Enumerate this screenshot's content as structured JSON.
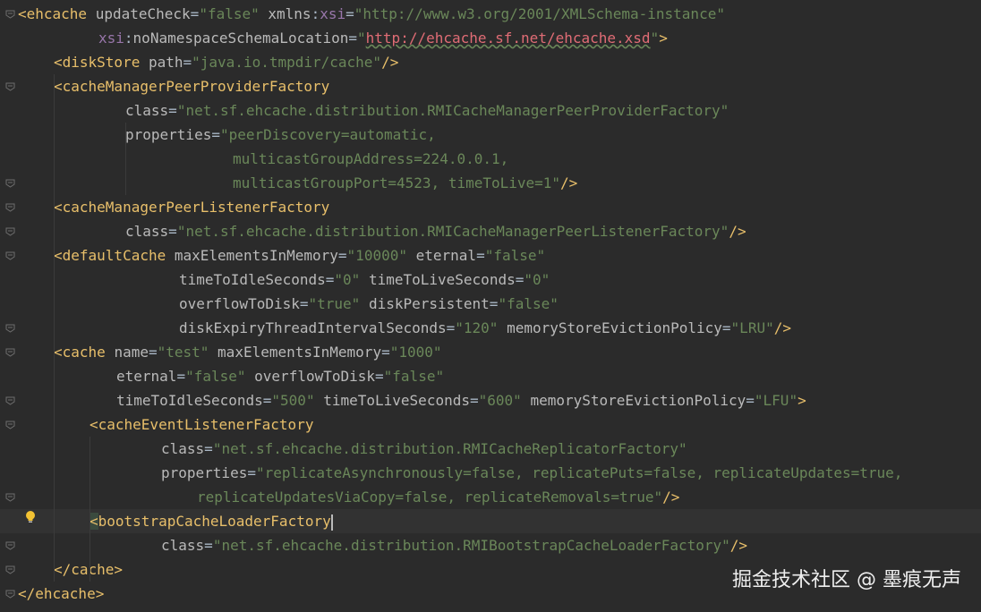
{
  "editor": {
    "lines": [
      {
        "indent": 0,
        "tokens": [
          {
            "c": "t-tag",
            "t": "<ehcache"
          },
          {
            "c": "t-plain",
            "t": " "
          },
          {
            "c": "t-attr",
            "t": "updateCheck"
          },
          {
            "c": "t-plain",
            "t": "="
          },
          {
            "c": "t-val",
            "t": "\"false\""
          },
          {
            "c": "t-plain",
            "t": " "
          },
          {
            "c": "t-attr",
            "t": "xmlns"
          },
          {
            "c": "t-plain",
            "t": ":"
          },
          {
            "c": "t-ns",
            "t": "xsi"
          },
          {
            "c": "t-plain",
            "t": "="
          },
          {
            "c": "t-val",
            "t": "\"http://www.w3.org/2001/XMLSchema-instance\""
          }
        ]
      },
      {
        "indent": 9,
        "tokens": [
          {
            "c": "t-ns",
            "t": "xsi"
          },
          {
            "c": "t-plain",
            "t": ":"
          },
          {
            "c": "t-attr",
            "t": "noNamespaceSchemaLocation"
          },
          {
            "c": "t-plain",
            "t": "="
          },
          {
            "c": "t-val",
            "t": "\""
          },
          {
            "c": "t-url",
            "t": "http://ehcache.sf.net/ehcache.xsd"
          },
          {
            "c": "t-val",
            "t": "\""
          },
          {
            "c": "t-tag",
            "t": ">"
          }
        ]
      },
      {
        "indent": 4,
        "tokens": [
          {
            "c": "t-tag",
            "t": "<diskStore"
          },
          {
            "c": "t-plain",
            "t": " "
          },
          {
            "c": "t-attr",
            "t": "path"
          },
          {
            "c": "t-plain",
            "t": "="
          },
          {
            "c": "t-val",
            "t": "\"java.io.tmpdir/cache\""
          },
          {
            "c": "t-tag",
            "t": "/>"
          }
        ]
      },
      {
        "indent": 4,
        "tokens": [
          {
            "c": "t-tag",
            "t": "<cacheManagerPeerProviderFactory"
          }
        ]
      },
      {
        "indent": 12,
        "tokens": [
          {
            "c": "t-attr",
            "t": "class"
          },
          {
            "c": "t-plain",
            "t": "="
          },
          {
            "c": "t-val",
            "t": "\"net.sf.ehcache.distribution.RMICacheManagerPeerProviderFactory\""
          }
        ]
      },
      {
        "indent": 12,
        "tokens": [
          {
            "c": "t-attr",
            "t": "properties"
          },
          {
            "c": "t-plain",
            "t": "="
          },
          {
            "c": "t-val",
            "t": "\"peerDiscovery=automatic,"
          }
        ]
      },
      {
        "indent": 24,
        "tokens": [
          {
            "c": "t-val",
            "t": "multicastGroupAddress=224.0.0.1,"
          }
        ]
      },
      {
        "indent": 24,
        "tokens": [
          {
            "c": "t-val",
            "t": "multicastGroupPort=4523, timeToLive=1\""
          },
          {
            "c": "t-tag",
            "t": "/>"
          }
        ]
      },
      {
        "indent": 4,
        "tokens": [
          {
            "c": "t-tag",
            "t": "<cacheManagerPeerListenerFactory"
          }
        ]
      },
      {
        "indent": 12,
        "tokens": [
          {
            "c": "t-attr",
            "t": "class"
          },
          {
            "c": "t-plain",
            "t": "="
          },
          {
            "c": "t-val",
            "t": "\"net.sf.ehcache.distribution.RMICacheManagerPeerListenerFactory\""
          },
          {
            "c": "t-tag",
            "t": "/>"
          }
        ]
      },
      {
        "indent": 4,
        "tokens": [
          {
            "c": "t-tag",
            "t": "<defaultCache"
          },
          {
            "c": "t-plain",
            "t": " "
          },
          {
            "c": "t-attr",
            "t": "maxElementsInMemory"
          },
          {
            "c": "t-plain",
            "t": "="
          },
          {
            "c": "t-val",
            "t": "\"10000\""
          },
          {
            "c": "t-plain",
            "t": " "
          },
          {
            "c": "t-attr",
            "t": "eternal"
          },
          {
            "c": "t-plain",
            "t": "="
          },
          {
            "c": "t-val",
            "t": "\"false\""
          }
        ]
      },
      {
        "indent": 18,
        "tokens": [
          {
            "c": "t-attr",
            "t": "timeToIdleSeconds"
          },
          {
            "c": "t-plain",
            "t": "="
          },
          {
            "c": "t-val",
            "t": "\"0\""
          },
          {
            "c": "t-plain",
            "t": " "
          },
          {
            "c": "t-attr",
            "t": "timeToLiveSeconds"
          },
          {
            "c": "t-plain",
            "t": "="
          },
          {
            "c": "t-val",
            "t": "\"0\""
          }
        ]
      },
      {
        "indent": 18,
        "tokens": [
          {
            "c": "t-attr",
            "t": "overflowToDisk"
          },
          {
            "c": "t-plain",
            "t": "="
          },
          {
            "c": "t-val",
            "t": "\"true\""
          },
          {
            "c": "t-plain",
            "t": " "
          },
          {
            "c": "t-attr",
            "t": "diskPersistent"
          },
          {
            "c": "t-plain",
            "t": "="
          },
          {
            "c": "t-val",
            "t": "\"false\""
          }
        ]
      },
      {
        "indent": 18,
        "tokens": [
          {
            "c": "t-attr",
            "t": "diskExpiryThreadIntervalSeconds"
          },
          {
            "c": "t-plain",
            "t": "="
          },
          {
            "c": "t-val",
            "t": "\"120\""
          },
          {
            "c": "t-plain",
            "t": " "
          },
          {
            "c": "t-attr",
            "t": "memoryStoreEvictionPolicy"
          },
          {
            "c": "t-plain",
            "t": "="
          },
          {
            "c": "t-val",
            "t": "\"LRU\""
          },
          {
            "c": "t-tag",
            "t": "/>"
          }
        ]
      },
      {
        "indent": 4,
        "tokens": [
          {
            "c": "t-tag",
            "t": "<cache"
          },
          {
            "c": "t-plain",
            "t": " "
          },
          {
            "c": "t-attr",
            "t": "name"
          },
          {
            "c": "t-plain",
            "t": "="
          },
          {
            "c": "t-val",
            "t": "\"test\""
          },
          {
            "c": "t-plain",
            "t": " "
          },
          {
            "c": "t-attr",
            "t": "maxElementsInMemory"
          },
          {
            "c": "t-plain",
            "t": "="
          },
          {
            "c": "t-val",
            "t": "\"1000\""
          }
        ]
      },
      {
        "indent": 11,
        "tokens": [
          {
            "c": "t-attr",
            "t": "eternal"
          },
          {
            "c": "t-plain",
            "t": "="
          },
          {
            "c": "t-val",
            "t": "\"false\""
          },
          {
            "c": "t-plain",
            "t": " "
          },
          {
            "c": "t-attr",
            "t": "overflowToDisk"
          },
          {
            "c": "t-plain",
            "t": "="
          },
          {
            "c": "t-val",
            "t": "\"false\""
          }
        ]
      },
      {
        "indent": 11,
        "tokens": [
          {
            "c": "t-attr",
            "t": "timeToIdleSeconds"
          },
          {
            "c": "t-plain",
            "t": "="
          },
          {
            "c": "t-val",
            "t": "\"500\""
          },
          {
            "c": "t-plain",
            "t": " "
          },
          {
            "c": "t-attr",
            "t": "timeToLiveSeconds"
          },
          {
            "c": "t-plain",
            "t": "="
          },
          {
            "c": "t-val",
            "t": "\"600\""
          },
          {
            "c": "t-plain",
            "t": " "
          },
          {
            "c": "t-attr",
            "t": "memoryStoreEvictionPolicy"
          },
          {
            "c": "t-plain",
            "t": "="
          },
          {
            "c": "t-val",
            "t": "\"LFU\""
          },
          {
            "c": "t-tag",
            "t": ">"
          }
        ]
      },
      {
        "indent": 8,
        "tokens": [
          {
            "c": "t-tag",
            "t": "<cacheEventListenerFactory"
          }
        ]
      },
      {
        "indent": 16,
        "tokens": [
          {
            "c": "t-attr",
            "t": "class"
          },
          {
            "c": "t-plain",
            "t": "="
          },
          {
            "c": "t-val",
            "t": "\"net.sf.ehcache.distribution.RMICacheReplicatorFactory\""
          }
        ]
      },
      {
        "indent": 16,
        "tokens": [
          {
            "c": "t-attr",
            "t": "properties"
          },
          {
            "c": "t-plain",
            "t": "="
          },
          {
            "c": "t-val",
            "t": "\"replicateAsynchronously=false, replicatePuts=false, replicateUpdates=true,"
          }
        ]
      },
      {
        "indent": 20,
        "tokens": [
          {
            "c": "t-val",
            "t": "replicateUpdatesViaCopy=false, replicateRemovals=true\""
          },
          {
            "c": "t-tag",
            "t": "/>"
          }
        ]
      },
      {
        "indent": 8,
        "current": true,
        "tokens": [
          {
            "c": "t-tag tag-highlight",
            "t": "<"
          },
          {
            "c": "t-tag",
            "t": "bootstrapCacheLoaderFactory"
          }
        ],
        "caret": true
      },
      {
        "indent": 16,
        "tokens": [
          {
            "c": "t-attr",
            "t": "class"
          },
          {
            "c": "t-plain",
            "t": "="
          },
          {
            "c": "t-val",
            "t": "\"net.sf.ehcache.distribution.RMIBootstrapCacheLoaderFactory\""
          },
          {
            "c": "t-tag",
            "t": "/>"
          }
        ]
      },
      {
        "indent": 4,
        "tokens": [
          {
            "c": "t-tag",
            "t": "</cache>"
          }
        ]
      },
      {
        "indent": 0,
        "tokens": [
          {
            "c": "t-tag",
            "t": "</ehcache>"
          }
        ]
      }
    ]
  },
  "icons": {
    "intention_bulb": "lightbulb-icon",
    "fold_marker": "fold-marker-icon"
  },
  "colors": {
    "background": "#2b2b2b",
    "tag": "#e8bf6a",
    "attribute": "#bababa",
    "namespace": "#9876aa",
    "value": "#6a8759"
  },
  "watermark": {
    "text": "掘金技术社区 @ 墨痕无声"
  }
}
